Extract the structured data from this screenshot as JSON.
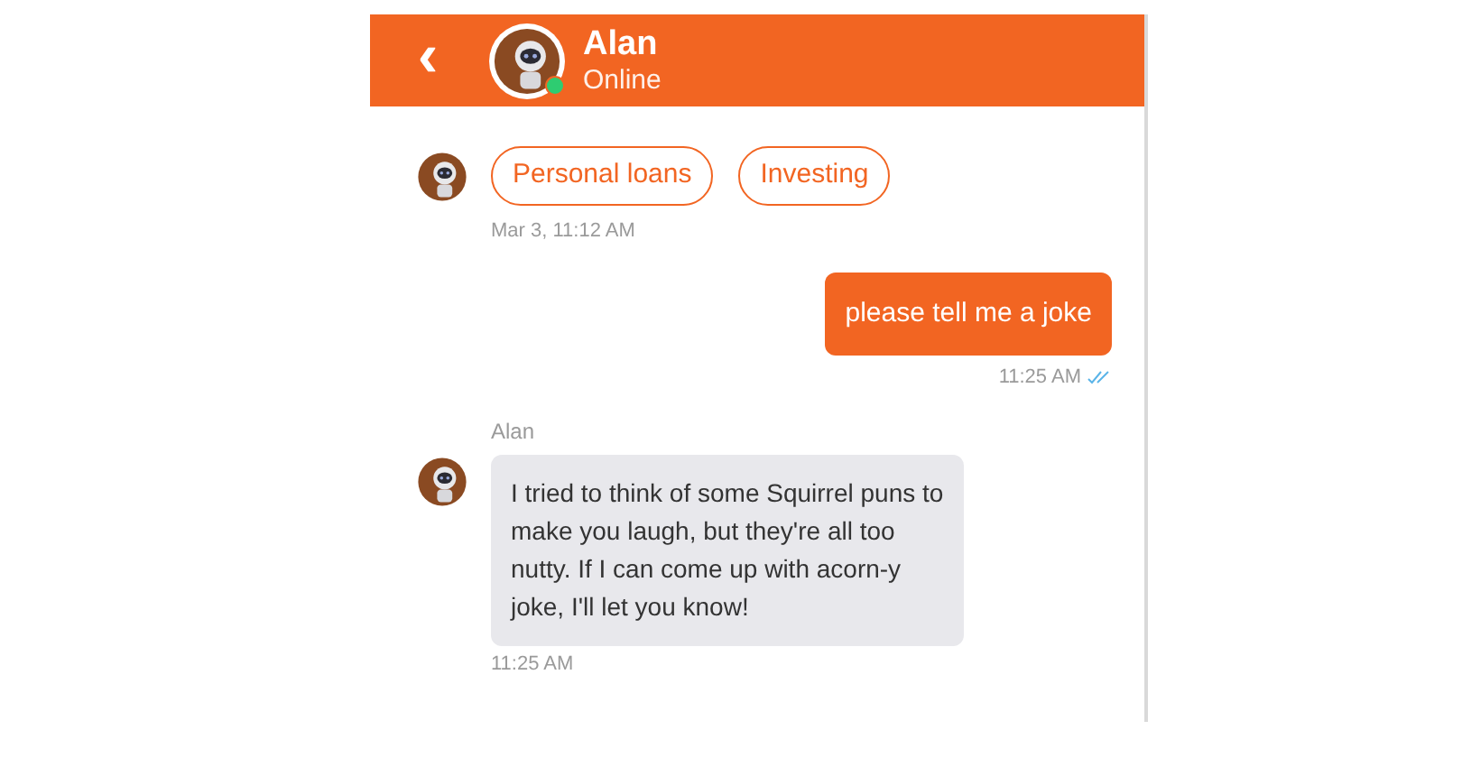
{
  "header": {
    "back": "‹",
    "name": "Alan",
    "status": "Online",
    "online": true
  },
  "messages": [
    {
      "kind": "chips",
      "chips": [
        "Personal loans",
        "Investing"
      ],
      "time": "Mar 3, 11:12 AM"
    },
    {
      "kind": "outgoing",
      "text": "please tell me a joke",
      "time": "11:25 AM",
      "read": true
    },
    {
      "kind": "incoming",
      "sender": "Alan",
      "text": "I tried to think of some Squirrel puns to make you laugh, but they're all too nutty. If I can come up with acorn-y joke, I'll let you know!",
      "time": "11:25 AM"
    }
  ]
}
